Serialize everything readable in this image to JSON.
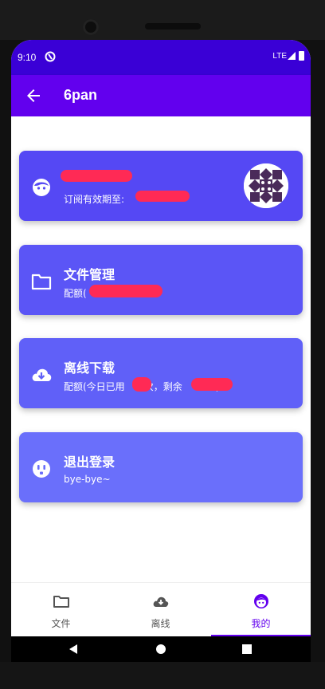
{
  "status": {
    "time": "9:10",
    "network": "LTE"
  },
  "appbar": {
    "title": "6pan"
  },
  "cards": [
    {
      "title": "",
      "subtitle": "订阅有效期至:",
      "icon": "face-icon",
      "color": "#5548f4"
    },
    {
      "title": "文件管理",
      "subtitle": "配额(",
      "icon": "folder-icon",
      "color": "#5b55f6"
    },
    {
      "title": "离线下载",
      "subtitle": "配额(今日已用",
      "subtitle_mid": "次，剩余",
      "subtitle_end": ")",
      "icon": "cloud-download-icon",
      "color": "#6060f8"
    },
    {
      "title": "退出登录",
      "subtitle": "bye-bye~",
      "icon": "outlet-icon",
      "color": "#6a6ffb"
    }
  ],
  "bottom_nav": [
    {
      "label": "文件",
      "icon": "folder-icon",
      "active": false
    },
    {
      "label": "离线",
      "icon": "cloud-download-icon",
      "active": false
    },
    {
      "label": "我的",
      "icon": "face-icon",
      "active": true
    }
  ],
  "colors": {
    "statusbar": "#3a00d6",
    "appbar": "#6200ee",
    "accent": "#6200ee",
    "redaction": "#ff2a55"
  }
}
